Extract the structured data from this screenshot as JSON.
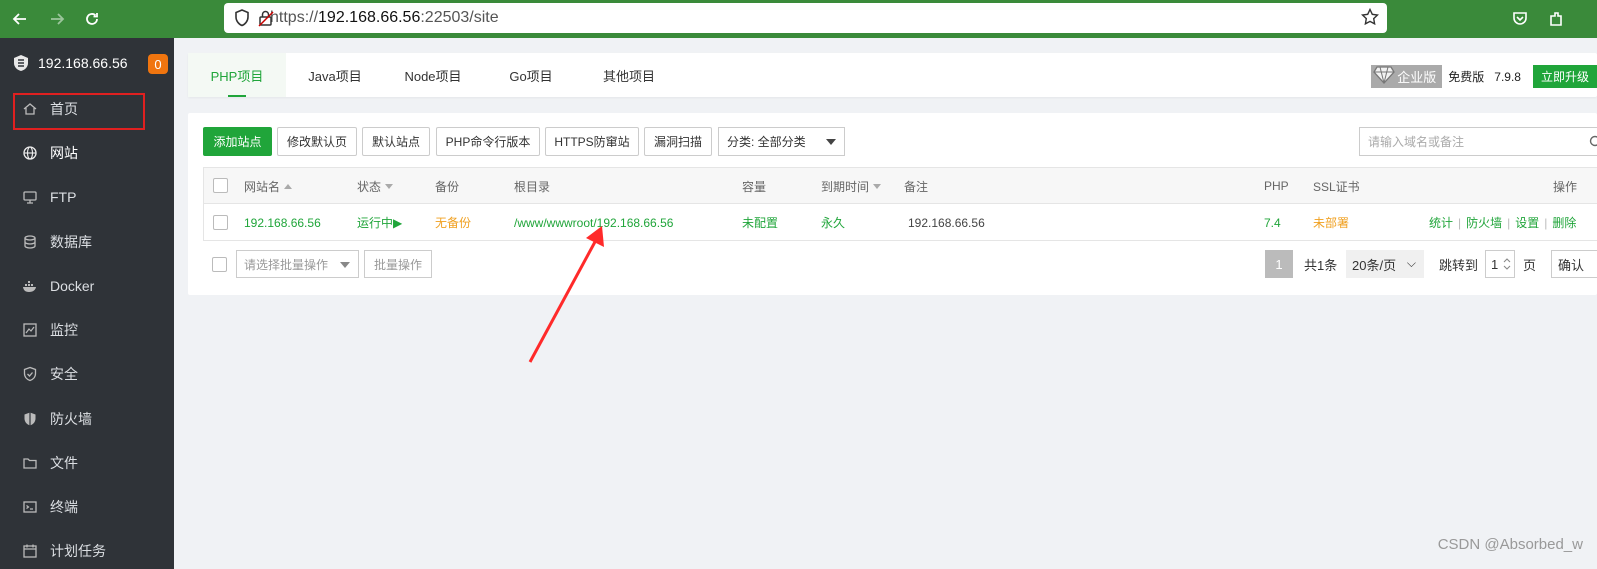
{
  "browser": {
    "url_scheme": "https://",
    "url_host": "192.168.66.56",
    "url_rest": ":22503/site"
  },
  "sidebar": {
    "server_name": "192.168.66.56",
    "badge_count": "0",
    "items": [
      {
        "label": "首页",
        "icon": "home-icon"
      },
      {
        "label": "网站",
        "icon": "globe-icon"
      },
      {
        "label": "FTP",
        "icon": "ftp-icon"
      },
      {
        "label": "数据库",
        "icon": "database-icon"
      },
      {
        "label": "Docker",
        "icon": "docker-icon"
      },
      {
        "label": "监控",
        "icon": "monitor-icon"
      },
      {
        "label": "安全",
        "icon": "shield-icon"
      },
      {
        "label": "防火墙",
        "icon": "firewall-icon"
      },
      {
        "label": "文件",
        "icon": "folder-icon"
      },
      {
        "label": "终端",
        "icon": "terminal-icon"
      },
      {
        "label": "计划任务",
        "icon": "calendar-icon"
      }
    ]
  },
  "tabs": [
    {
      "label": "PHP项目"
    },
    {
      "label": "Java项目"
    },
    {
      "label": "Node项目"
    },
    {
      "label": "Go项目"
    },
    {
      "label": "其他项目"
    }
  ],
  "edition": {
    "enterprise": "企业版",
    "free": "免费版",
    "version": "7.9.8",
    "upgrade": "立即升级"
  },
  "toolbar": {
    "add_site": "添加站点",
    "modify_default": "修改默认页",
    "default_site": "默认站点",
    "php_cli": "PHP命令行版本",
    "https_guard": "HTTPS防窜站",
    "vuln_scan": "漏洞扫描",
    "category": "分类: 全部分类",
    "search_placeholder": "请输入域名或备注"
  },
  "table": {
    "headers": {
      "name": "网站名",
      "status": "状态",
      "backup": "备份",
      "root": "根目录",
      "capacity": "容量",
      "expire": "到期时间",
      "remark": "备注",
      "php": "PHP",
      "ssl": "SSL证书",
      "ops": "操作"
    },
    "rows": [
      {
        "name": "192.168.66.56",
        "status": "运行中▶",
        "backup": "无备份",
        "root": "/www/wwwroot/192.168.66.56",
        "capacity": "未配置",
        "expire": "永久",
        "remark": "192.168.66.56",
        "php": "7.4",
        "ssl": "未部署",
        "ops": [
          "统计",
          "防火墙",
          "设置",
          "删除"
        ]
      }
    ]
  },
  "batch": {
    "select_placeholder": "请选择批量操作",
    "button": "批量操作"
  },
  "pager": {
    "current_page": "1",
    "total": "共1条",
    "per_page": "20条/页",
    "jump_label": "跳转到",
    "jump_value": "1",
    "page_unit": "页",
    "confirm": "确认"
  },
  "watermark": "CSDN @Absorbed_w",
  "colors": {
    "accent": "#20a53a",
    "sidebar_bg": "#2f3338",
    "browser_bar": "#3a8a3a",
    "highlight": "#e02020"
  }
}
